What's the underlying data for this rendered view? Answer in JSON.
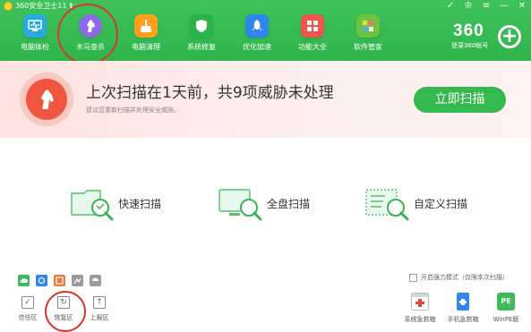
{
  "window": {
    "title": "360安全卫士11",
    "upgrade_icon": "up-arrow-icon",
    "controls": [
      "skin-icon",
      "shirt-icon",
      "menu-icon",
      "minimize-icon",
      "close-icon"
    ],
    "control_glyphs": [
      "✓",
      "♔",
      "≡",
      "—",
      "✕"
    ]
  },
  "nav": {
    "items": [
      {
        "label": "电脑体检",
        "icon": "pc-checkup-icon",
        "color": "#2aa9e0"
      },
      {
        "label": "木马查杀",
        "icon": "horse-shield-icon",
        "color": "#8d6be8"
      },
      {
        "label": "电脑清理",
        "icon": "broom-icon",
        "color": "#ff9f1c"
      },
      {
        "label": "系统修复",
        "icon": "shield-icon",
        "color": "#2bb24c"
      },
      {
        "label": "优化加速",
        "icon": "rocket-icon",
        "color": "#2f86eb"
      },
      {
        "label": "功能大全",
        "icon": "grid-icon",
        "color": "#f0564b"
      },
      {
        "label": "软件管家",
        "icon": "apps-icon",
        "color": "#6ac63f"
      }
    ],
    "active_index": 1
  },
  "account": {
    "brand": "360",
    "login_label": "登录360帐号",
    "plus_glyph": "+"
  },
  "warning": {
    "title": "上次扫描在1天前，共9项威胁未处理",
    "subtitle": "建议您重新扫描并处理安全威胁。",
    "button_label": "立即扫描",
    "accent": "#f0563d"
  },
  "scan_options": [
    {
      "label": "快速扫描",
      "icon": "folder-scan-icon"
    },
    {
      "label": "全盘扫描",
      "icon": "monitor-scan-icon"
    },
    {
      "label": "自定义扫描",
      "icon": "checklist-scan-icon"
    }
  ],
  "mini_icons": [
    {
      "icon": "cloud-engine-icon",
      "color": "#3dbb5a"
    },
    {
      "icon": "ai-engine-icon",
      "color": "#2f86eb"
    },
    {
      "icon": "qvm-engine-icon",
      "color": "#f07a3d"
    },
    {
      "icon": "system-repair-engine-icon",
      "color": "#9a9a9a"
    },
    {
      "icon": "bitdefender-engine-icon",
      "color": "#9a9a9a"
    }
  ],
  "tools": [
    {
      "label": "信任区",
      "icon": "trust-zone-icon",
      "glyph": "✓"
    },
    {
      "label": "恢复区",
      "icon": "restore-zone-icon",
      "glyph": "↻"
    },
    {
      "label": "上报区",
      "icon": "report-zone-icon",
      "glyph": "↑"
    }
  ],
  "forced_mode": {
    "label": "开启强力模式（仅限本次扫描）",
    "checked": false
  },
  "rescue_tools": [
    {
      "label": "系统急救箱",
      "icon": "first-aid-kit-icon",
      "color": "#ffffff"
    },
    {
      "label": "手机急救箱",
      "icon": "phone-first-aid-icon",
      "color": "#2f86eb"
    },
    {
      "label": "WinPE版",
      "icon": "winpe-icon",
      "color": "#3dbb5a",
      "glyph": "PE"
    }
  ]
}
